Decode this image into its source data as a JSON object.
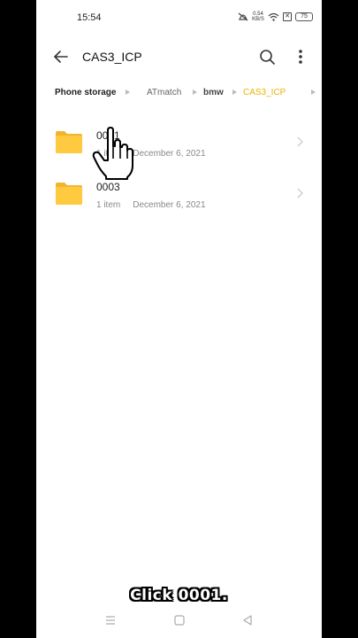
{
  "status_bar": {
    "time": "15:54",
    "net_speed_value": "0.54",
    "net_speed_unit": "KB/S",
    "battery": "75"
  },
  "app_bar": {
    "title": "CAS3_ICP"
  },
  "breadcrumb": [
    {
      "label": "Phone storage"
    },
    {
      "label": "ATmatch"
    },
    {
      "label": "bmw"
    },
    {
      "label": "CAS3_ICP"
    }
  ],
  "files": [
    {
      "name": "0001",
      "items": "1 item",
      "date": "December 6, 2021"
    },
    {
      "name": "0003",
      "items": "1 item",
      "date": "December 6, 2021"
    }
  ],
  "caption": "Click 0001.",
  "colors": {
    "accent": "#e8b400",
    "folder": "#ffc940",
    "folder_tab": "#f2b42e"
  },
  "icons": {
    "back": "arrow-left",
    "search": "magnifier",
    "more": "vertical-dots",
    "folder": "folder",
    "cursor": "pointing-hand"
  }
}
